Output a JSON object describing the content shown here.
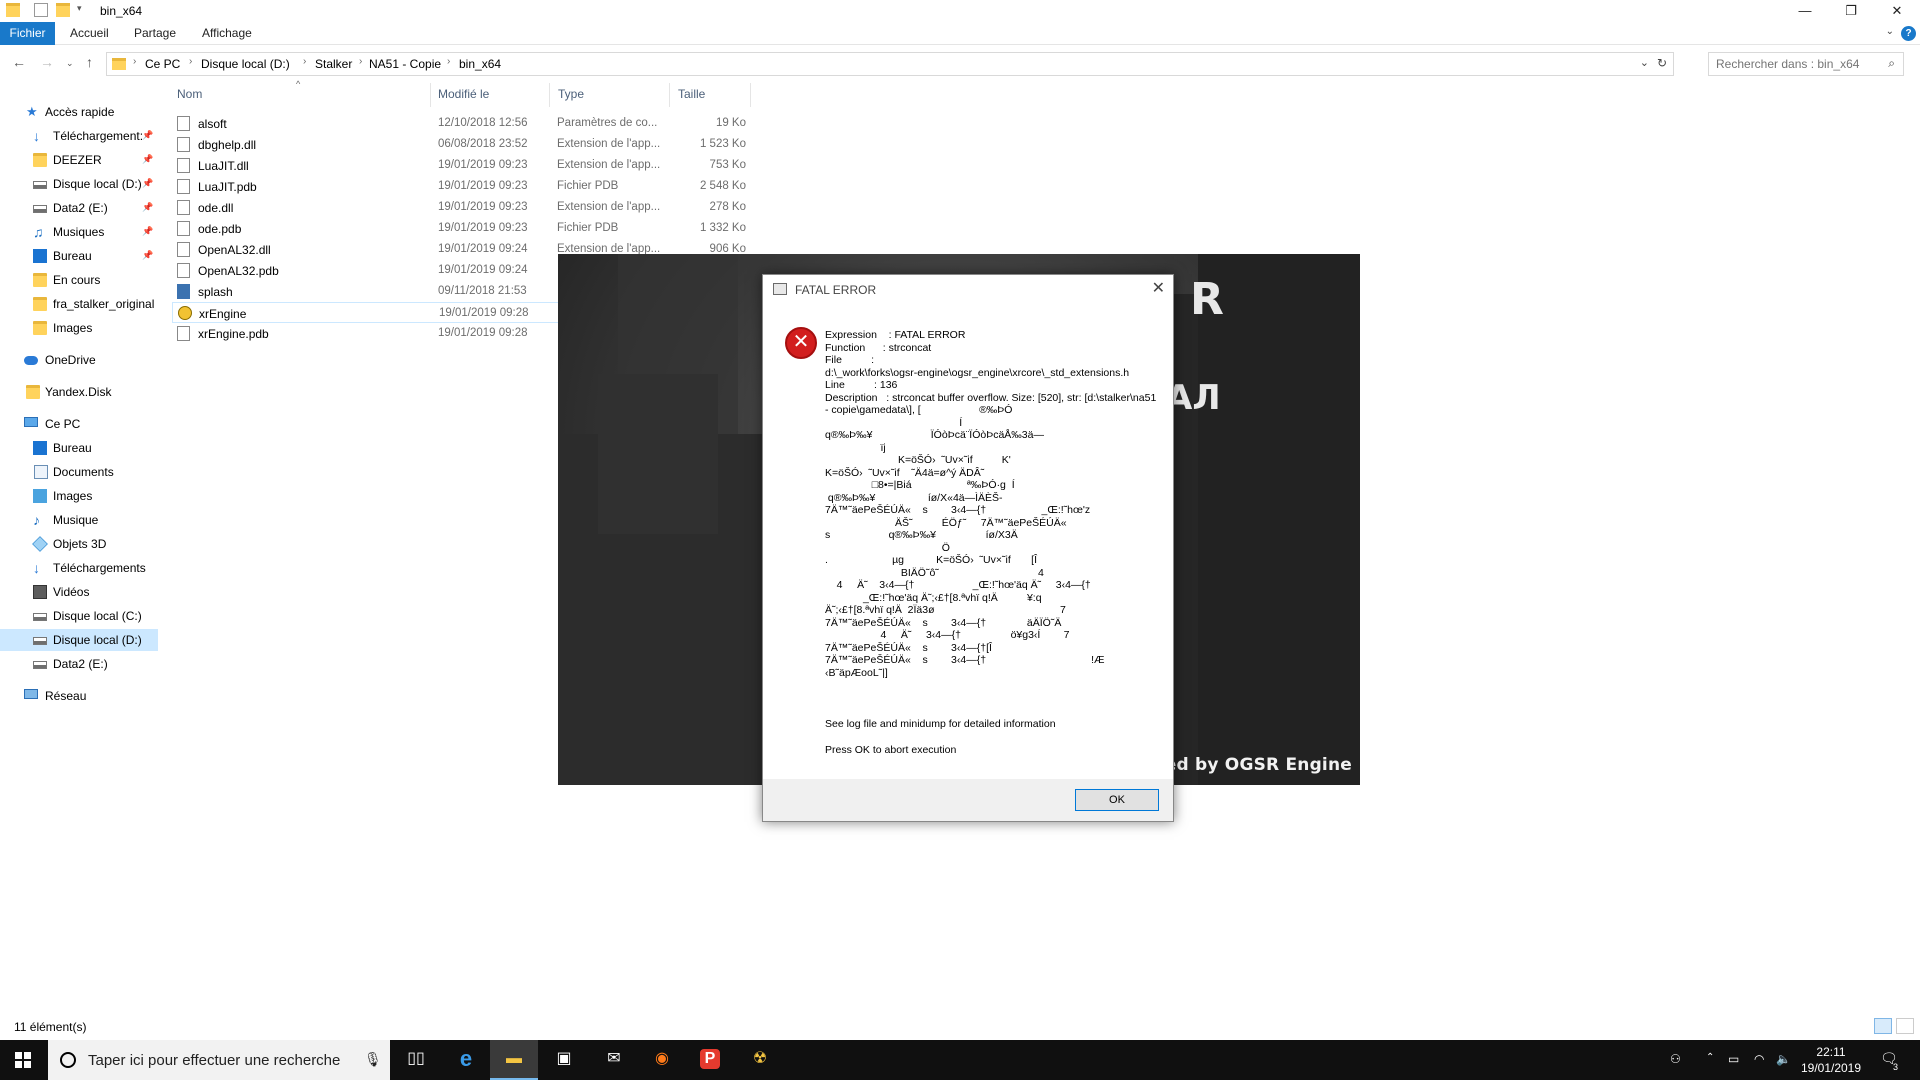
{
  "window": {
    "title": "bin_x64",
    "controls": {
      "minimize": "—",
      "maximize": "❐",
      "close": "✕"
    }
  },
  "ribbon": {
    "tabs": [
      "Fichier",
      "Accueil",
      "Partage",
      "Affichage"
    ],
    "help": "?"
  },
  "address": {
    "crumbs": [
      "Ce PC",
      "Disque local (D:)",
      "Stalker",
      "NA51 - Copie",
      "bin_x64"
    ],
    "search_placeholder": "Rechercher dans : bin_x64"
  },
  "sidebar": {
    "items": [
      {
        "label": "Accès rapide",
        "icon": "star-icon",
        "pinned": false
      },
      {
        "label": "Téléchargement:",
        "icon": "download-icon",
        "pinned": true
      },
      {
        "label": "DEEZER",
        "icon": "folder-icon",
        "pinned": true
      },
      {
        "label": "Disque local (D:)",
        "icon": "drive-icon",
        "pinned": true
      },
      {
        "label": "Data2 (E:)",
        "icon": "drive-icon",
        "pinned": true
      },
      {
        "label": "Musiques",
        "icon": "music-folder-icon",
        "pinned": true
      },
      {
        "label": "Bureau",
        "icon": "desktop-folder-icon",
        "pinned": true
      },
      {
        "label": "En cours",
        "icon": "folder-icon",
        "pinned": false
      },
      {
        "label": "fra_stalker_original",
        "icon": "folder-icon",
        "pinned": false
      },
      {
        "label": "Images",
        "icon": "folder-icon",
        "pinned": false
      },
      {
        "label": "OneDrive",
        "icon": "cloud-icon",
        "pinned": false
      },
      {
        "label": "Yandex.Disk",
        "icon": "folder-icon",
        "pinned": false
      },
      {
        "label": "Ce PC",
        "icon": "computer-icon",
        "pinned": false
      },
      {
        "label": "Bureau",
        "icon": "desktop-folder-icon",
        "pinned": false
      },
      {
        "label": "Documents",
        "icon": "documents-icon",
        "pinned": false
      },
      {
        "label": "Images",
        "icon": "pictures-icon",
        "pinned": false
      },
      {
        "label": "Musique",
        "icon": "music-icon",
        "pinned": false
      },
      {
        "label": "Objets 3D",
        "icon": "3d-objects-icon",
        "pinned": false
      },
      {
        "label": "Téléchargements",
        "icon": "download-icon",
        "pinned": false
      },
      {
        "label": "Vidéos",
        "icon": "videos-icon",
        "pinned": false
      },
      {
        "label": "Disque local (C:)",
        "icon": "drive-icon",
        "pinned": false
      },
      {
        "label": "Disque local (D:)",
        "icon": "drive-icon",
        "pinned": false
      },
      {
        "label": "Data2 (E:)",
        "icon": "drive-icon",
        "pinned": false
      },
      {
        "label": "Réseau",
        "icon": "network-icon",
        "pinned": false
      }
    ],
    "pin_glyph": "📌"
  },
  "filelist": {
    "columns": [
      "Nom",
      "Modifié le",
      "Type",
      "Taille"
    ],
    "files": [
      {
        "name": "alsoft",
        "date": "12/10/2018 12:56",
        "type": "Paramètres de co...",
        "size": "19 Ko",
        "icon": "settings-file-icon"
      },
      {
        "name": "dbghelp.dll",
        "date": "06/08/2018 23:52",
        "type": "Extension de l'app...",
        "size": "1 523 Ko",
        "icon": "dll-file-icon"
      },
      {
        "name": "LuaJIT.dll",
        "date": "19/01/2019 09:23",
        "type": "Extension de l'app...",
        "size": "753 Ko",
        "icon": "dll-file-icon"
      },
      {
        "name": "LuaJIT.pdb",
        "date": "19/01/2019 09:23",
        "type": "Fichier PDB",
        "size": "2 548 Ko",
        "icon": "file-icon"
      },
      {
        "name": "ode.dll",
        "date": "19/01/2019 09:23",
        "type": "Extension de l'app...",
        "size": "278 Ko",
        "icon": "dll-file-icon"
      },
      {
        "name": "ode.pdb",
        "date": "19/01/2019 09:23",
        "type": "Fichier PDB",
        "size": "1 332 Ko",
        "icon": "file-icon"
      },
      {
        "name": "OpenAL32.dll",
        "date": "19/01/2019 09:24",
        "type": "Extension de l'app...",
        "size": "906 Ko",
        "icon": "dll-file-icon"
      },
      {
        "name": "OpenAL32.pdb",
        "date": "19/01/2019 09:24",
        "type": "",
        "size": "",
        "icon": "file-icon"
      },
      {
        "name": "splash",
        "date": "09/11/2018 21:53",
        "type": "",
        "size": "",
        "icon": "image-file-icon"
      },
      {
        "name": "xrEngine",
        "date": "19/01/2019 09:28",
        "type": "",
        "size": "",
        "icon": "radiation-app-icon"
      },
      {
        "name": "xrEngine.pdb",
        "date": "19/01/2019 09:28",
        "type": "",
        "size": "",
        "icon": "file-icon"
      }
    ]
  },
  "status": {
    "count": "11 élément(s)"
  },
  "splash": {
    "powered": "Powered by OGSR Engine",
    "logo_top": "R",
    "logo_bottom": "АЛ"
  },
  "dialog": {
    "title": "FATAL ERROR",
    "message": "Expression    : FATAL ERROR\nFunction      : strconcat\nFile          :\nd:\\_work\\forks\\ogsr-engine\\ogsr_engine\\xrcore\\_std_extensions.h\nLine          : 136\nDescription   : strconcat buffer overflow. Size: [520], str: [d:\\stalker\\na51 - copie\\gamedata\\], [                    ®‰ÞÓ\n                                              Í\nq®‰Þ‰¥                    ÏÓòÞcä¨ÏÓòÞcäÅ‰3ä—\n                   ïj\n                         K=öŠÓ›  ˜Uv×˜if          K'\nK=öŠÓ›  ˜Uv×˜if    ˜Ä4ä=ø^ý ÄDÂ˜\n                □8•=|Biá                   ª‰ÞÓ·g  Í\n q®‰Þ‰¥                  íø/X«4ä—ÌÄÈŠ-\n7Ä™˜äePeŠÉÚÄ«    s        3‹4—{†                   _Œ:!˜hœ'z\n                        ÄŠ˜          ÉÖƒ˜     7Ä™˜äePeŠÉÚÄ«\ns                    q®‰Þ‰¥                 íø/X3Ä\n                                        Ö\n.                      µg           K=öŠÓ›  ˜Uv×˜if       [Î\n                          BIÄÖ˜ô˜                                  4\n    4     Ä˜    3‹4—{†                    _Œ:!˜hœ'äq Ä˜     3‹4—{†\n             _Œ:!˜hœ'äq Ä˜;‹£†[8.ªvhï q!Ä          ¥:q\nÄ˜;‹£†[8.ªvhï q!Ä  2Ïä3ø                                           7\n7Ä™˜äePeŠÉÚÄ«    s        3‹4—{†              äÄÏÖ˜Ä\n                   4     Ä˜     3‹4—{†                 ö¥g3‹Í        7\n7Ä™˜äePeŠÉÚÄ«    s        3‹4—{†[Î\n7Ä™˜äePeŠÉÚÄ«    s        3‹4—{†                                    !Æ\n‹B˜äpÆooL˜|]",
    "log_text": "See log file and minidump for detailed information",
    "abort_text": "Press OK to abort execution",
    "ok_label": "OK"
  },
  "taskbar": {
    "search_placeholder": "Taper ici pour effectuer une recherche",
    "apps": [
      {
        "name": "task-view",
        "glyph": "▯▯",
        "active": false
      },
      {
        "name": "edge",
        "glyph": "e",
        "active": false
      },
      {
        "name": "file-explorer",
        "glyph": "▬",
        "active": true
      },
      {
        "name": "store",
        "glyph": "▣",
        "active": false
      },
      {
        "name": "mail",
        "glyph": "✉",
        "active": false
      },
      {
        "name": "firefox",
        "glyph": "◉",
        "active": false
      },
      {
        "name": "pocket-casts",
        "glyph": "P",
        "active": false
      },
      {
        "name": "stalker",
        "glyph": "☢",
        "active": false
      }
    ],
    "time": "22:11",
    "date": "19/01/2019",
    "notifications": "3"
  }
}
